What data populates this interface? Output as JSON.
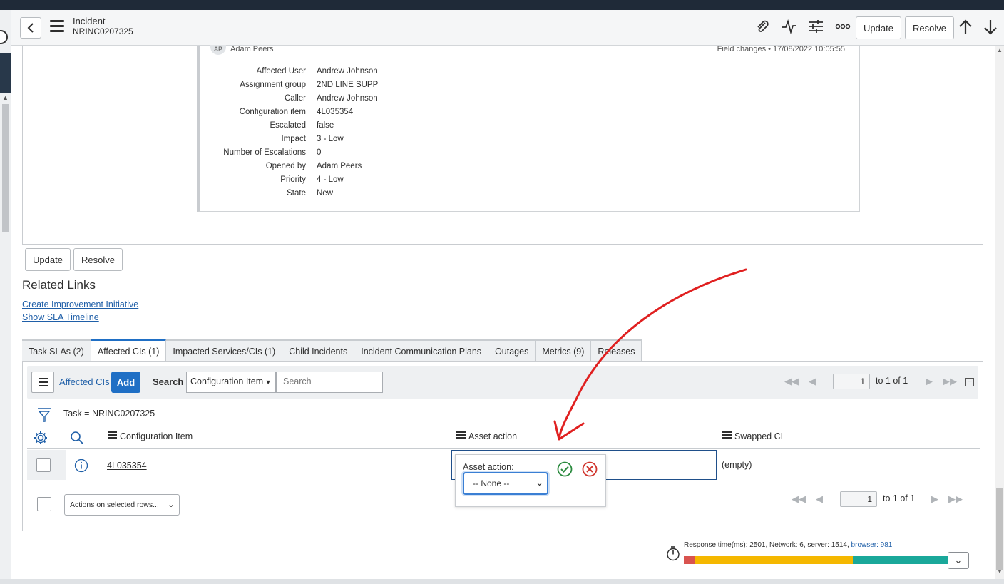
{
  "header": {
    "title": "Incident",
    "number": "NRINC0207325",
    "update_label": "Update",
    "resolve_label": "Resolve"
  },
  "audit": {
    "avatar": "AP",
    "user": "Adam Peers",
    "changes": "Field changes  •  17/08/2022 10:05:55",
    "fields": [
      {
        "label": "Affected User",
        "value": "Andrew Johnson"
      },
      {
        "label": "Assignment group",
        "value": "2ND LINE SUPP"
      },
      {
        "label": "Caller",
        "value": "Andrew Johnson"
      },
      {
        "label": "Configuration item",
        "value": "4L035354"
      },
      {
        "label": "Escalated",
        "value": "false"
      },
      {
        "label": "Impact",
        "value": "3 - Low"
      },
      {
        "label": "Number of Escalations",
        "value": "0"
      },
      {
        "label": "Opened by",
        "value": "Adam Peers"
      },
      {
        "label": "Priority",
        "value": "4 - Low"
      },
      {
        "label": "State",
        "value": "New"
      }
    ]
  },
  "form_buttons": {
    "update": "Update",
    "resolve": "Resolve"
  },
  "related_links": {
    "title": "Related Links",
    "links": [
      "Create Improvement Initiative",
      "Show SLA Timeline"
    ]
  },
  "tabs": [
    "Task SLAs (2)",
    "Affected CIs (1)",
    "Impacted Services/CIs (1)",
    "Child Incidents",
    "Incident Communication Plans",
    "Outages",
    "Metrics (9)",
    "Releases"
  ],
  "list": {
    "title": "Affected CIs",
    "add_label": "Add",
    "search_label": "Search",
    "search_field": "Configuration Item",
    "search_placeholder": "Search",
    "page": "1",
    "page_total": "to 1 of 1",
    "filter": "Task = NRINC0207325",
    "columns": [
      "Configuration Item",
      "Asset action",
      "Swapped CI"
    ],
    "rows": [
      {
        "ci": "4L035354",
        "asset_action": "",
        "swapped_ci": "(empty)"
      }
    ],
    "actions_label": "Actions on selected rows..."
  },
  "popup": {
    "label": "Asset action:",
    "selected": "-- None --"
  },
  "response": {
    "text": "Response time(ms): 2501, Network: 6, server: 1514, ",
    "browser": "browser: 981",
    "segments": [
      {
        "value": 6,
        "color": "#d9534f"
      },
      {
        "value": 1514,
        "color": "#f5b800"
      },
      {
        "value": 981,
        "color": "#1aa89a"
      }
    ]
  }
}
